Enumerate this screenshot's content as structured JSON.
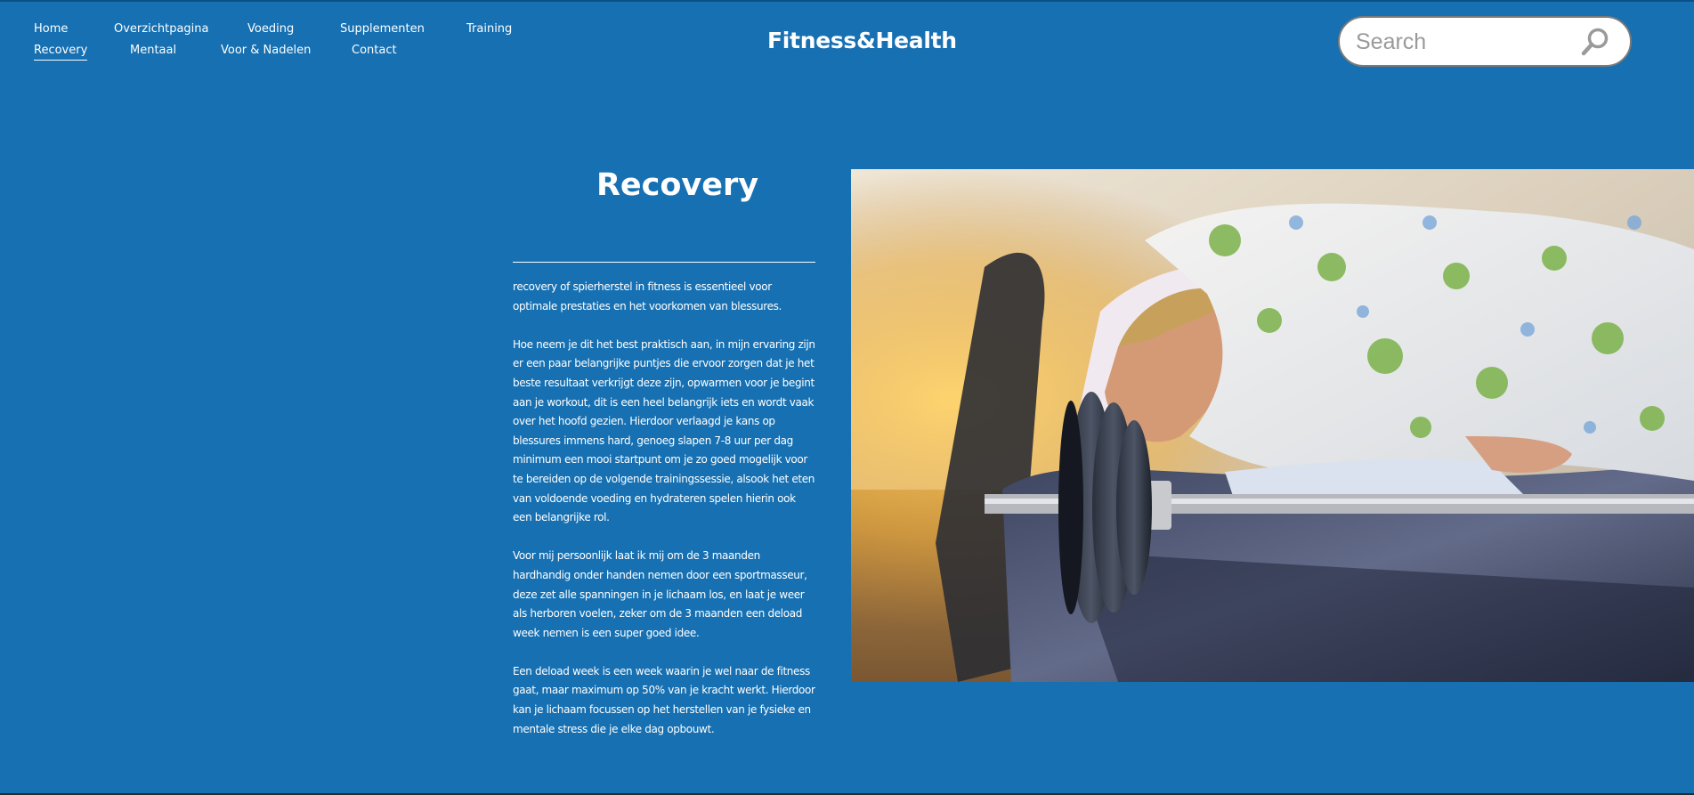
{
  "nav": {
    "items": [
      {
        "label": "Home",
        "active": false
      },
      {
        "label": "Overzichtpagina",
        "active": false
      },
      {
        "label": "Voeding",
        "active": false
      },
      {
        "label": "Supplementen",
        "active": false
      },
      {
        "label": "Training",
        "active": false
      },
      {
        "label": "Recovery",
        "active": true
      },
      {
        "label": "Mentaal",
        "active": false
      },
      {
        "label": "Voor & Nadelen",
        "active": false
      },
      {
        "label": "Contact",
        "active": false
      }
    ]
  },
  "site": {
    "logo": "Fitness&Health"
  },
  "search": {
    "placeholder": "Search",
    "icon": "search-icon"
  },
  "page": {
    "title": "Recovery",
    "paragraphs": [
      "recovery of spierherstel in fitness is essentieel voor optimale prestaties en het voorkomen van blessures.",
      "Hoe neem je dit het best praktisch aan, in mijn ervaring zijn er een paar belangrijke puntjes die ervoor zorgen dat je het beste resultaat verkrijgt deze zijn, opwarmen voor je begint aan je workout, dit is een heel belangrijk iets en wordt vaak over het hoofd gezien. Hierdoor verlaagd je kans op blessures immens hard, genoeg slapen 7-8 uur per dag minimum een mooi startpunt om je zo goed mogelijk voor te bereiden op de volgende trainingssessie, alsook het eten van voldoende voeding en hydrateren spelen hierin ook een belangrijke rol.",
      "Voor mij persoonlijk laat ik mij om de 3 maanden hardhandig onder handen nemen door een sportmasseur, deze zet alle spanningen in je lichaam los, en laat je weer als herboren voelen, zeker om de 3 maanden een deload week nemen is een super goed idee.",
      "Een deload week is een week waarin je wel naar de fitness gaat, maar maximum op 50% van je kracht werkt. Hierdoor kan je lichaam focussen op het herstellen van je fysieke en mentale stress die je elke dag opbouwt."
    ]
  },
  "colors": {
    "background": "#1670b2",
    "text": "#ffffff",
    "search_bg": "#ffffff",
    "search_border": "#7a7a7a"
  }
}
